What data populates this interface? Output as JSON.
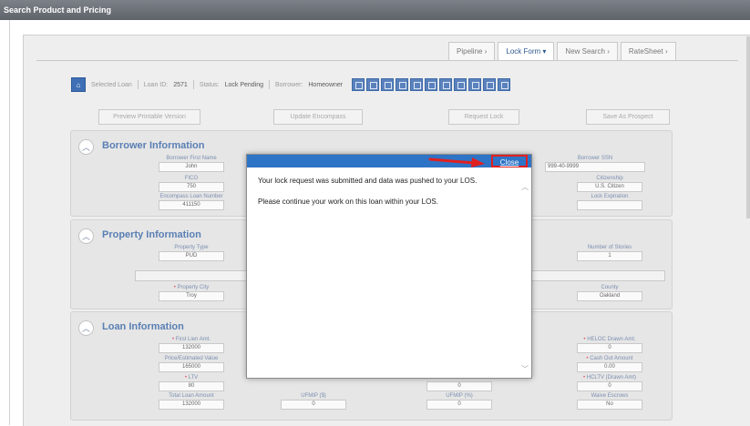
{
  "window": {
    "title": "Search Product and Pricing"
  },
  "tabs": [
    {
      "label": "Pipeline",
      "chevron": "›"
    },
    {
      "label": "Lock Form",
      "chevron": "▾"
    },
    {
      "label": "New Search",
      "chevron": "›"
    },
    {
      "label": "RateSheet",
      "chevron": "›"
    }
  ],
  "status": {
    "selected_loan_label": "Selected Loan",
    "loan_id_label": "Loan ID:",
    "loan_id": "2571",
    "status_label": "Status:",
    "status_value": "Lock Pending",
    "borrower_label": "Borrower:",
    "borrower_value": "Homeowner"
  },
  "actions": {
    "preview_btn": "Preview Printable Version",
    "update_btn": "Update Encompass",
    "request_btn": "Request Lock",
    "save_btn": "Save As Prospect"
  },
  "borrower": {
    "title": "Borrower Information",
    "first_name_label": "Borrower First Name",
    "first_name": "John",
    "fico_label": "FICO",
    "fico": "750",
    "loan_number_label": "Encompass Loan Number",
    "loan_number": "411150",
    "ssn_label": "Borrower SSN",
    "ssn": "999-40-9999",
    "citizenship_label": "Citizenship",
    "citizenship": "U.S. Citizen",
    "lock_exp_label": "Lock Expiration",
    "lock_exp": ""
  },
  "property": {
    "title": "Property Information",
    "type_label": "Property Type",
    "type": "PUD",
    "stories_label": "Number of Stories",
    "stories": "1",
    "city_label": "Property City",
    "city": "Troy",
    "county_label": "County",
    "county": "Oakland"
  },
  "loan": {
    "title": "Loan Information",
    "first_lien_label": "First Lien Amt.",
    "first_lien": "132000",
    "heloc_label": "HELOC Drawn Amt.",
    "heloc": "0",
    "value_label": "Price/Estimated Value",
    "value": "165000",
    "cashout_label": "Cash Out Amount",
    "cashout": "0.00",
    "ltv_label": "LTV",
    "ltv": "80",
    "hcltv_label": "HCLTV (Drawn Amt)",
    "hcltv": "0",
    "total_label": "Total Loan Amount",
    "total": "132000",
    "ufmip_label": "UFMIP ($)",
    "ufmip": "0",
    "ufmip_pct_label": "UFMIP (%)",
    "ufmip_pct": "0",
    "waive_label": "Waive Escrows",
    "waive": "No"
  },
  "modal": {
    "close_label": "Close",
    "message_1": "Your lock request was submitted and data was pushed to your LOS.",
    "message_2": "Please continue your work on this loan within your LOS."
  },
  "colors": {
    "modal_header": "#2e74c6",
    "highlight": "#e02020",
    "section_title": "#5a7fb4"
  },
  "icons": [
    "home-icon",
    "toolbar-icons",
    "collapse-icon",
    "red-arrow"
  ]
}
